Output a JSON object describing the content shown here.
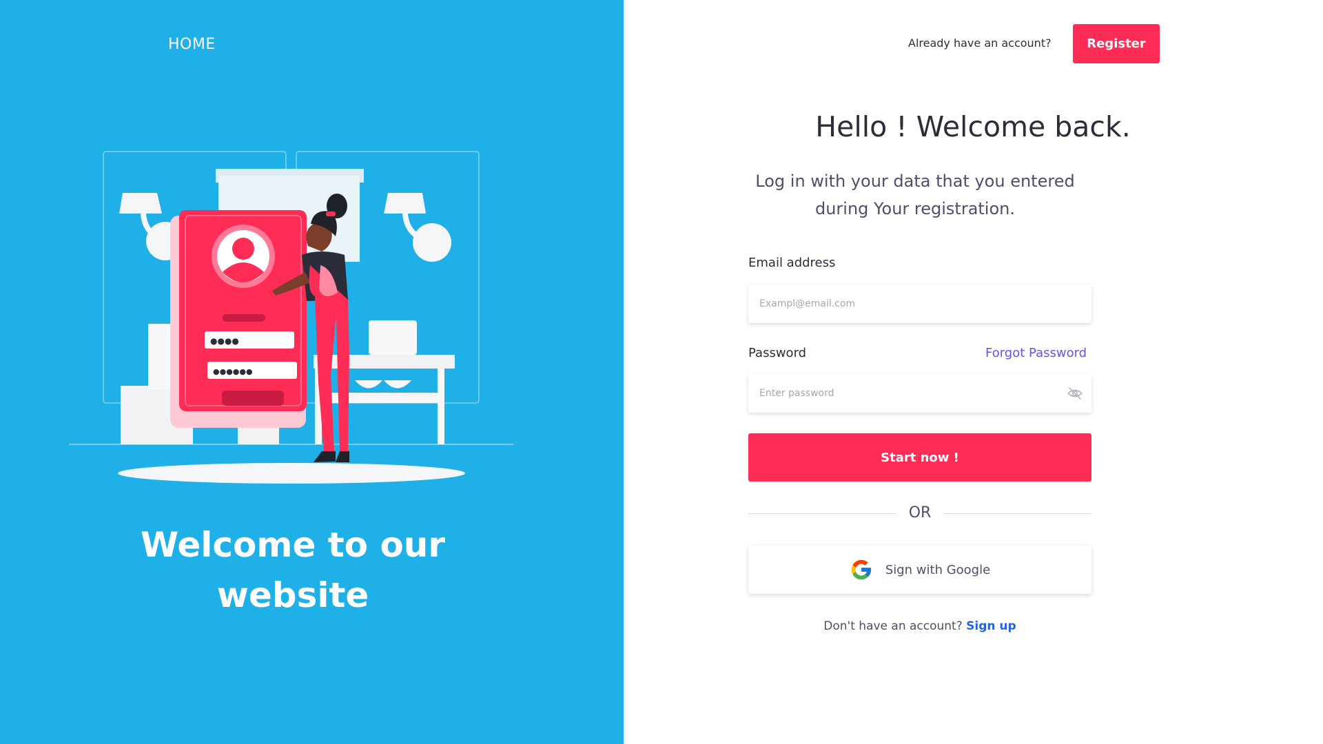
{
  "left": {
    "home_label": "HOME",
    "welcome_title_line1": "Welcome to our",
    "welcome_title_line2": "website",
    "illustration": {
      "password_dots_1": "●●●●",
      "password_dots_2": "●●●●●●"
    }
  },
  "header": {
    "prompt": "Already have an account?",
    "register_label": "Register"
  },
  "main": {
    "title": "Hello ! Welcome back.",
    "subtitle": "Log in with your data that you entered during Your registration."
  },
  "form": {
    "email_label": "Email address",
    "email_placeholder": "Exampl@email.com",
    "email_value": "",
    "password_label": "Password",
    "forgot_password": "Forgot Password",
    "password_placeholder": "Enter password",
    "password_value": "",
    "password_toggle_icon": "eye-off-icon",
    "submit_label": "Start now !",
    "or_label": "OR",
    "google_label": "Sign with Google",
    "google_icon": "google-icon",
    "signup_prompt": "Don't have an account?",
    "signup_link": "Sign up"
  },
  "colors": {
    "left_panel_bg": "#1eb0e6",
    "accent": "#ff2c55",
    "forgot_link": "#6c4ff0",
    "signup_link": "#2364e3",
    "heading_text": "#2b2d39"
  }
}
